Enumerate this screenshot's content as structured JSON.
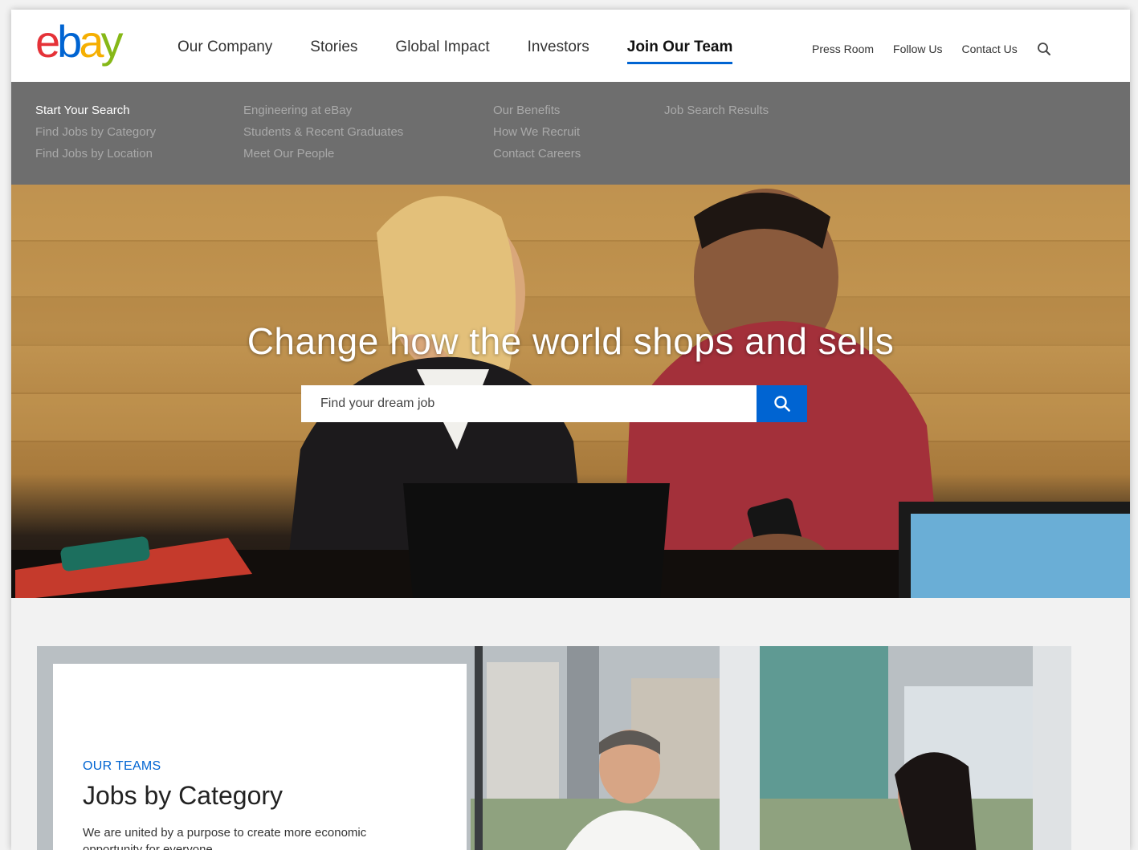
{
  "brand": {
    "logo_letters": [
      "e",
      "b",
      "a",
      "y"
    ],
    "colors": {
      "red": "#e53238",
      "blue": "#0064d2",
      "yellow": "#f5af02",
      "green": "#86b817"
    }
  },
  "main_nav": {
    "items": [
      {
        "label": "Our Company"
      },
      {
        "label": "Stories"
      },
      {
        "label": "Global Impact"
      },
      {
        "label": "Investors"
      },
      {
        "label": "Join Our Team",
        "active": true
      }
    ]
  },
  "util_nav": {
    "items": [
      {
        "label": "Press Room"
      },
      {
        "label": "Follow Us"
      },
      {
        "label": "Contact Us"
      }
    ],
    "search_icon": "search-icon"
  },
  "submenu": {
    "columns": [
      [
        "Start Your Search",
        "Find Jobs by Category",
        "Find Jobs by Location"
      ],
      [
        "Engineering at eBay",
        "Students & Recent Graduates",
        "Meet Our People"
      ],
      [
        "Our Benefits",
        "How We Recruit",
        "Contact Careers"
      ],
      [
        "Job Search Results"
      ]
    ],
    "current": "Start Your Search"
  },
  "hero": {
    "title": "Change how the world shops and sells",
    "search_placeholder": "Find your dream job",
    "button_icon": "search-icon"
  },
  "teams": {
    "eyebrow": "OUR TEAMS",
    "title": "Jobs by Category",
    "description": "We are united by a purpose to create more economic opportunity for everyone."
  }
}
